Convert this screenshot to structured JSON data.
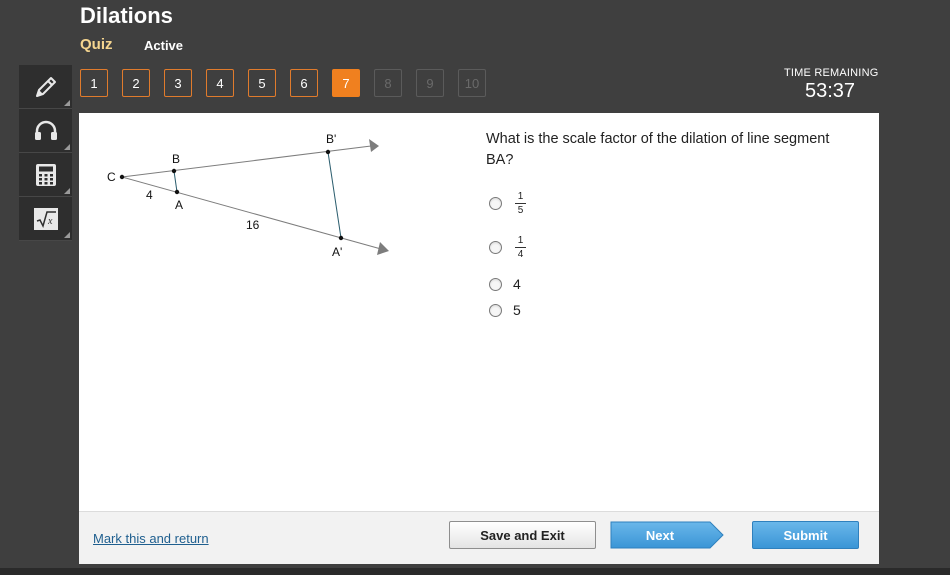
{
  "header": {
    "title": "Dilations",
    "mode": "Quiz",
    "status": "Active"
  },
  "question_nav": {
    "items": [
      {
        "label": "1",
        "state": "normal"
      },
      {
        "label": "2",
        "state": "normal"
      },
      {
        "label": "3",
        "state": "normal"
      },
      {
        "label": "4",
        "state": "normal"
      },
      {
        "label": "5",
        "state": "normal"
      },
      {
        "label": "6",
        "state": "normal"
      },
      {
        "label": "7",
        "state": "current"
      },
      {
        "label": "8",
        "state": "disabled"
      },
      {
        "label": "9",
        "state": "disabled"
      },
      {
        "label": "10",
        "state": "disabled"
      }
    ]
  },
  "timer": {
    "label": "TIME REMAINING",
    "value": "53:37"
  },
  "toolbar": {
    "tools": [
      "pencil-icon",
      "headphones-icon",
      "calculator-icon",
      "square-root-icon"
    ]
  },
  "diagram": {
    "points": {
      "C": "C",
      "B": "B",
      "A": "A",
      "B_prime": "B'",
      "A_prime": "A'"
    },
    "lengths": {
      "CA": "4",
      "AA_prime": "16"
    }
  },
  "question": {
    "text": "What is the scale factor of the dilation of line segment BA?",
    "options": [
      {
        "type": "fraction",
        "numerator": "1",
        "denominator": "5"
      },
      {
        "type": "fraction",
        "numerator": "1",
        "denominator": "4"
      },
      {
        "type": "text",
        "value": "4"
      },
      {
        "type": "text",
        "value": "5"
      }
    ]
  },
  "footer": {
    "mark_link": "Mark this and return",
    "save_label": "Save and Exit",
    "next_label": "Next",
    "submit_label": "Submit"
  },
  "colors": {
    "accent": "#f0801f",
    "quiz_label": "#f5d58f",
    "button_blue": "#4aa3e0",
    "link": "#1f5f8f",
    "segment": "#2b5d6e"
  }
}
